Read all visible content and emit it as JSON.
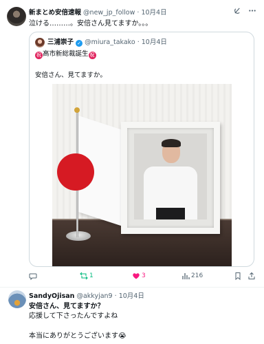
{
  "post": {
    "author_name": "新まとめ安倍速報",
    "author_handle": "@new_jp_follow",
    "separator": "·",
    "date": "10月4日",
    "text": "泣ける………。安倍さん見てますか。。。",
    "quote": {
      "author_name": "三浦崇子",
      "author_handle": "@miura_takako",
      "date": "10月4日",
      "title": "高市新総裁誕生",
      "badge_char": "祝",
      "body": "安倍さん、見てますか。"
    },
    "actions": {
      "retweets": "1",
      "likes": "3",
      "views": "216"
    },
    "colors": {
      "retweet": "#00ba7c",
      "like": "#f91880",
      "meta": "#536471",
      "verified": "#1d9bf0"
    }
  },
  "reply": {
    "author_name": "SandyOjisan",
    "author_handle": "@akkyjan9",
    "separator": "·",
    "date": "10月4日",
    "line1": "安倍さん、見てますか？",
    "line2": "応援して下さったんですよね",
    "line3": "本当にありがとうございます😭"
  }
}
